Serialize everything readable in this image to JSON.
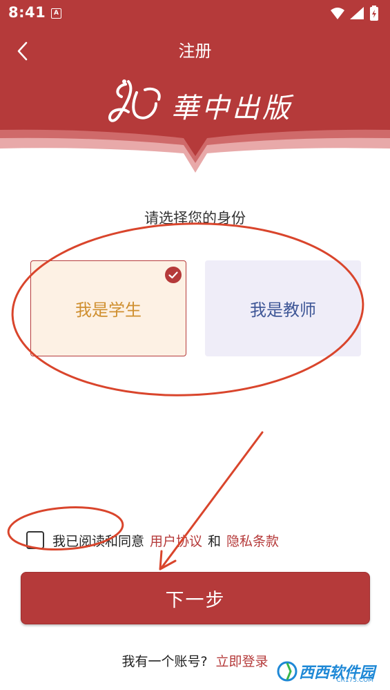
{
  "status_bar": {
    "time": "8:41",
    "notification_badge": "A"
  },
  "nav": {
    "title": "注册",
    "back_icon": "chevron-left-icon"
  },
  "brand": {
    "logo_text": "華中出版"
  },
  "role_select": {
    "prompt": "请选择您的身份",
    "options": [
      {
        "label": "我是学生",
        "selected": true
      },
      {
        "label": "我是教师",
        "selected": false
      }
    ]
  },
  "agreement": {
    "checked": false,
    "prefix": "我已阅读和同意",
    "user_agreement": "用户协议",
    "and": "和",
    "privacy_policy": "隐私条款"
  },
  "next_button": {
    "label": "下一步"
  },
  "login": {
    "prompt": "我有一个账号?",
    "link": "立即登录"
  },
  "watermark": {
    "text": "西西软件园",
    "sub": "CR173.COM"
  },
  "colors": {
    "brand_red": "#b53a3a",
    "student_text": "#cf8f2f",
    "student_bg": "#fdf1e4",
    "teacher_text": "#3f5797",
    "teacher_bg": "#efedf8",
    "annotation": "#d9452c"
  }
}
